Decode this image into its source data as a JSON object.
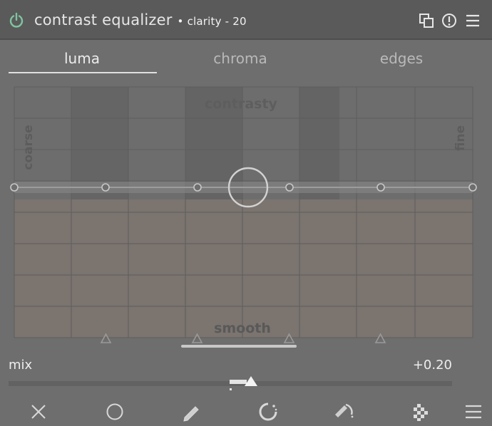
{
  "header": {
    "title": "contrast equalizer",
    "bullet": "•",
    "label": "clarity - 20",
    "power_color": "#7fc4a2",
    "icons": [
      "power-icon",
      "multi-instance-icon",
      "reset-icon",
      "presets-icon"
    ]
  },
  "tabs": [
    {
      "label": "luma",
      "active": true
    },
    {
      "label": "chroma",
      "active": false
    },
    {
      "label": "edges",
      "active": false
    }
  ],
  "graph": {
    "top_label": "contrasty",
    "bottom_label": "smooth",
    "left_label": "coarse",
    "right_label": "fine",
    "fill_color": "#7d7570",
    "node_levels": [
      0.5,
      0.5,
      0.5,
      0.5,
      0.5,
      0.5
    ],
    "selected_node_level": 0.5
  },
  "mix": {
    "label": "mix",
    "value": "+0.20",
    "fraction": 0.55
  },
  "footer": {
    "icons": [
      "uniform-mask-icon",
      "drawn-mask-icon",
      "parametric-mask-icon",
      "drawn-parametric-mask-icon",
      "raster-mask-icon",
      "blend-menu-icon"
    ],
    "off_icon": "close-icon"
  }
}
